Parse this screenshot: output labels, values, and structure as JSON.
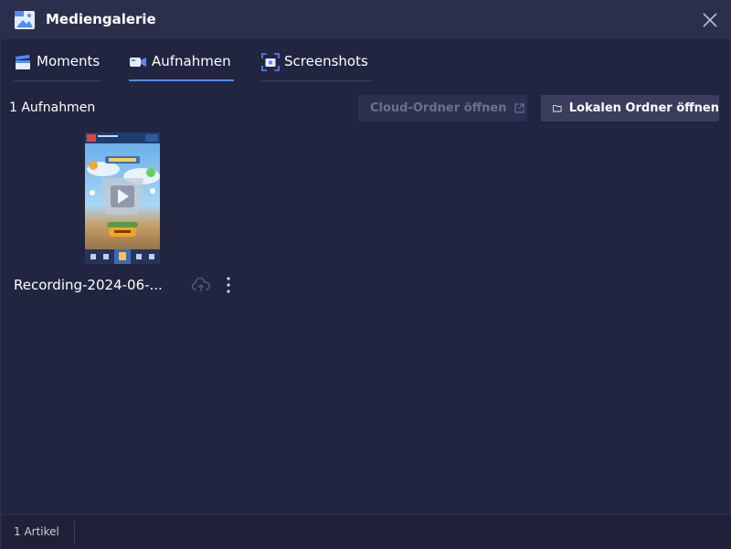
{
  "window": {
    "title": "Mediengalerie",
    "icon": "gallery-image-icon",
    "close_icon": "close-icon"
  },
  "tabs": [
    {
      "label": "Moments",
      "icon": "clapperboard-icon",
      "active": false
    },
    {
      "label": "Aufnahmen",
      "icon": "video-camera-icon",
      "active": true
    },
    {
      "label": "Screenshots",
      "icon": "screenshot-frame-icon",
      "active": false
    }
  ],
  "toolbar": {
    "count_text": "1 Aufnahmen",
    "cloud_button": {
      "label": "Cloud-Ordner öffnen",
      "enabled": false,
      "icon": "external-link-icon"
    },
    "local_button": {
      "label": "Lokalen Ordner öffnen",
      "enabled": true,
      "icon": "folder-icon"
    }
  },
  "recordings": [
    {
      "name": "Recording-2024-06-...",
      "actions": [
        "cloud-upload-icon",
        "more-vertical-icon"
      ]
    }
  ],
  "footer": {
    "item_count": "1 Artikel"
  },
  "colors": {
    "background": "#222540",
    "titlebar": "#2b2f4c",
    "accent": "#4f8cff",
    "button_primary": "#3a3e5c",
    "button_disabled_text": "#6c708a"
  }
}
